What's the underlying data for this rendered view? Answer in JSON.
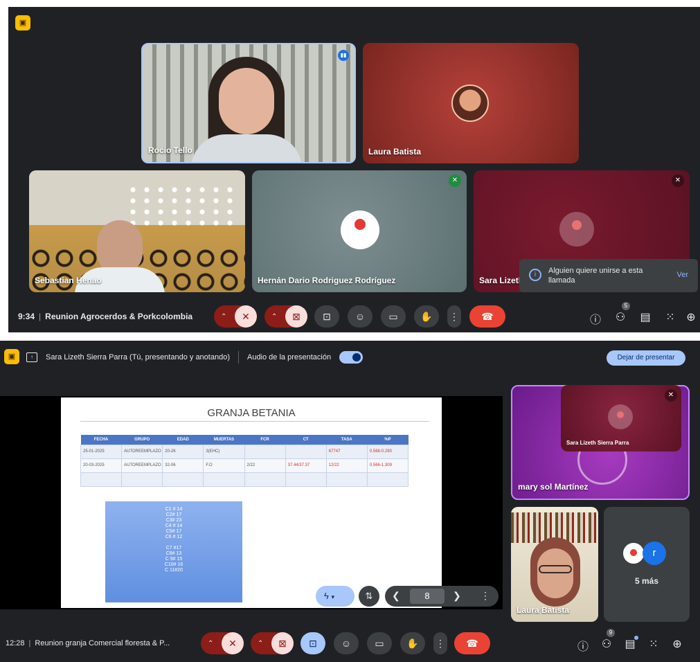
{
  "top": {
    "meeting_time": "9:34",
    "meeting_title": "Reunion Agrocerdos & Porkcolombia",
    "participants": [
      {
        "name": "Rocio Tello"
      },
      {
        "name": "Laura Batista"
      },
      {
        "name": "Sebastian Henao"
      },
      {
        "name": "Hernán Dario Rodriguez Rodríguez"
      },
      {
        "name": "Sara Lizeth"
      }
    ],
    "toast": {
      "text": "Alguien quiere unirse a esta llamada",
      "action": "Ver"
    },
    "people_count": "5"
  },
  "bottom": {
    "meeting_time": "12:28",
    "meeting_title": "Reunion granja Comercial floresta & P...",
    "presenting_label": "Sara Lizeth Sierra Parra (Tú, presentando y anotando)",
    "audio_label": "Audio de la presentación",
    "stop_button": "Dejar de presentar",
    "slide": {
      "title": "GRANJA BETANIA",
      "headers": [
        "FECHA",
        "GRUPO",
        "EDAD",
        "MUERTAS",
        "FCR",
        "CT",
        "TASA",
        "%P"
      ],
      "rows": [
        [
          "25-01-2025",
          "AUTOREEMPLAZO",
          "20-26",
          "3(EHC)",
          "",
          "",
          "67747",
          "0.568-0.290"
        ],
        [
          "20-03-2025",
          "AUTOREEMPLAZO",
          "32-06",
          "F.O",
          "2/22",
          "37.44/37.37",
          "12/22",
          "0.566-1.309"
        ]
      ],
      "box_lines": [
        "C1 # 14",
        "C2# 17",
        "C3# 23",
        "C4 # 14",
        "C5# 17",
        "C6 # 12",
        "",
        "C7 #17",
        "C8# 13",
        "C 9# 15",
        "C10# 16",
        "C 11#20"
      ],
      "page_number": "8"
    },
    "self_view_name": "Sara Lizeth Sierra Parra",
    "tiles": [
      {
        "name": "mary sol Martínez"
      },
      {
        "name": "Laura Batista"
      }
    ],
    "more_label": "5 más",
    "avatar_letter": "r",
    "people_count": "9"
  },
  "colors": {
    "bar_bg": "#202124",
    "mic_off_red": "#8c1d18",
    "hangup": "#ea4335",
    "accent_blue": "#a8c7fa",
    "purple_tile": "#8e24aa",
    "maroon_tile": "#6d1326"
  },
  "icons": [
    "shield-icon",
    "mic-off-icon",
    "camera-off-icon",
    "present-icon",
    "emoji-icon",
    "captions-icon",
    "raise-hand-icon",
    "more-icon",
    "hangup-icon",
    "info-icon",
    "people-icon",
    "chat-icon",
    "activities-icon",
    "host-controls-icon",
    "pen-icon",
    "pointer-icon",
    "chevron-left-icon",
    "chevron-right-icon"
  ]
}
